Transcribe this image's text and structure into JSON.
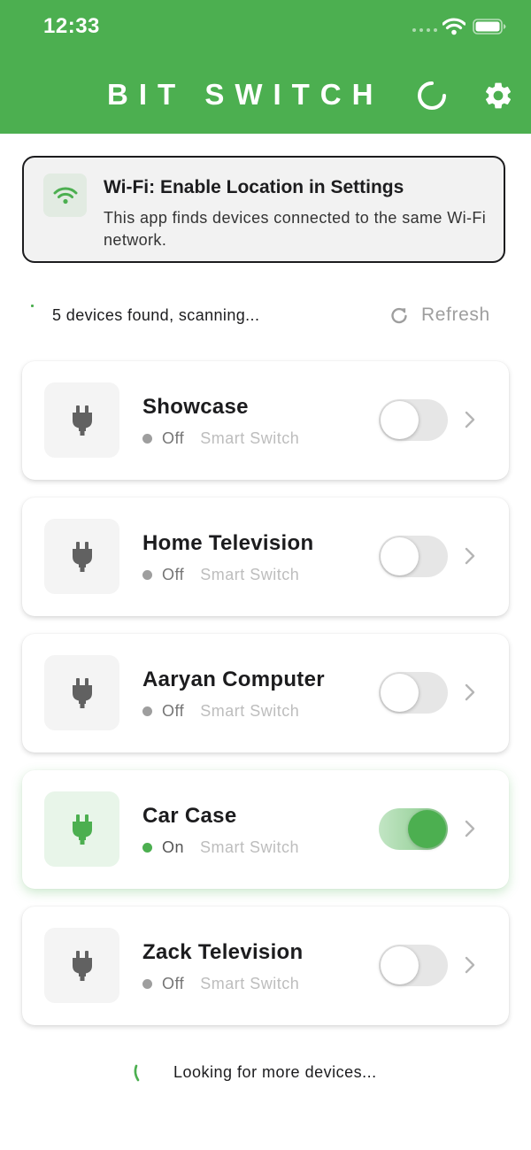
{
  "status_bar": {
    "time": "12:33"
  },
  "header": {
    "title": "BIT SWITCH"
  },
  "wifi_banner": {
    "title": "Wi-Fi: Enable Location in Settings",
    "text": "This app finds devices connected to the same Wi-Fi network."
  },
  "scan": {
    "status": "5 devices found, scanning...",
    "refresh_label": "Refresh"
  },
  "devices": [
    {
      "name": "Showcase",
      "state": "Off",
      "type": "Smart Switch",
      "on": false
    },
    {
      "name": "Home Television",
      "state": "Off",
      "type": "Smart Switch",
      "on": false
    },
    {
      "name": "Aaryan Computer",
      "state": "Off",
      "type": "Smart Switch",
      "on": false
    },
    {
      "name": "Car Case",
      "state": "On",
      "type": "Smart Switch",
      "on": true
    },
    {
      "name": "Zack Television",
      "state": "Off",
      "type": "Smart Switch",
      "on": false
    }
  ],
  "footer": {
    "loading_text": "Looking for more devices..."
  },
  "colors": {
    "brand_green": "#4caf50",
    "off_gray": "#9e9e9e",
    "banner_border": "#1c1c1e"
  },
  "icons": {
    "device": "plug-icon",
    "header_right": [
      "loading-spinner-icon",
      "gear-icon"
    ],
    "banner": "wifi-icon",
    "refresh": "refresh-icon",
    "row_action": "chevron-right-icon"
  }
}
